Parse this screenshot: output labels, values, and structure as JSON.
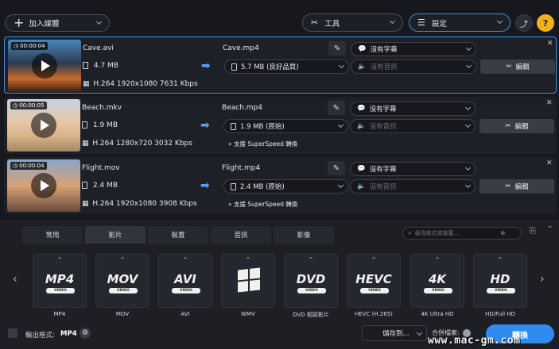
{
  "toolbar": {
    "add_media": "加入媒體",
    "tools": "工具",
    "settings": "設定"
  },
  "files": [
    {
      "duration": "00:00:04",
      "name": "Cave.avi",
      "size": "4.7 MB",
      "codec": "H.264 1920x1080 7631 Kbps",
      "out_name": "Cave.mp4",
      "out_size": "5.7 MB (良好品質)",
      "subtitle": "沒有字幕",
      "audio": "沒有音訊",
      "edit": "編輯",
      "superspeed": ""
    },
    {
      "duration": "00:00:05",
      "name": "Beach.mkv",
      "size": "1.9 MB",
      "codec": "H.264 1280x720 3032 Kbps",
      "out_name": "Beach.mp4",
      "out_size": "1.9 MB (原始)",
      "subtitle": "沒有字幕",
      "audio": "沒有音訊",
      "edit": "編輯",
      "superspeed": "支援 SuperSpeed 轉換"
    },
    {
      "duration": "00:00:04",
      "name": "Flight.mov",
      "size": "2.4 MB",
      "codec": "H.264 1920x1080 3908 Kbps",
      "out_name": "Flight.mp4",
      "out_size": "2.4 MB (原始)",
      "subtitle": "沒有字幕",
      "audio": "沒有音訊",
      "edit": "編輯",
      "superspeed": "支援 SuperSpeed 轉換"
    }
  ],
  "tabs": [
    "常用",
    "影片",
    "裝置",
    "音訊",
    "影像"
  ],
  "active_tab": "影片",
  "search": {
    "placeholder": "尋找格式或裝置..."
  },
  "formats": [
    {
      "logo": "MP4",
      "tag": "VIDEO",
      "label": "MP4"
    },
    {
      "logo": "MOV",
      "tag": "VIDEO",
      "label": "MOV"
    },
    {
      "logo": "AVI",
      "tag": "VIDEO",
      "label": "AVI"
    },
    {
      "logo": "",
      "tag": "",
      "label": "WMV"
    },
    {
      "logo": "DVD",
      "tag": "VIDEO",
      "label": "DVD 相容影片"
    },
    {
      "logo": "HEVC",
      "tag": "VIDEO",
      "label": "HEVC (H.265)"
    },
    {
      "logo": "4K",
      "tag": "VIDEO",
      "label": "4K Ultra HD"
    },
    {
      "logo": "HD",
      "tag": "VIDEO",
      "label": "HD/Full HD"
    }
  ],
  "footer": {
    "output_label": "輸出格式:",
    "output_value": "MP4",
    "save_to": "儲存到...",
    "merge": "合併檔案:",
    "convert": "轉換"
  },
  "watermark": "www.mac-gm.com",
  "colors": {
    "accent": "#2f8bf0",
    "background": "#16181e"
  }
}
